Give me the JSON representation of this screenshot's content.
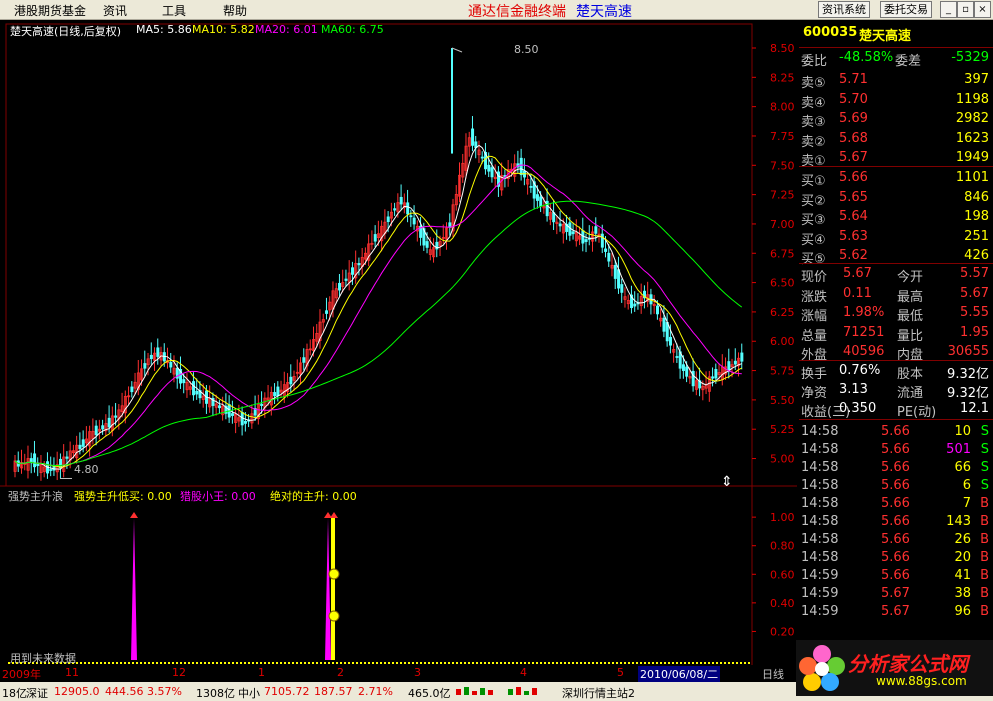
{
  "menubar": {
    "items": [
      "港股期货基金",
      "资讯",
      "工具",
      "帮助"
    ],
    "title_left": "通达信金融终端",
    "title_right": "楚天高速",
    "btn_news": "资讯系统",
    "btn_trade": "委托交易"
  },
  "main_chart": {
    "title": "楚天高速(日线,后复权)",
    "ma": [
      {
        "label": "MA5: 5.86",
        "color": "#ffffff"
      },
      {
        "label": "MA10: 5.82",
        "color": "#ffff00"
      },
      {
        "label": "MA20: 6.01",
        "color": "#ff00ff"
      },
      {
        "label": "MA60: 6.75",
        "color": "#00ff00"
      }
    ],
    "high_label": "8.50",
    "low_label": "4.80",
    "y_ticks": [
      "8.50",
      "8.25",
      "8.00",
      "7.75",
      "7.50",
      "7.25",
      "7.00",
      "6.75",
      "6.50",
      "6.25",
      "6.00",
      "5.75",
      "5.50",
      "5.25",
      "5.00"
    ]
  },
  "chart_data": {
    "type": "candlestick",
    "title": "楚天高速(日线,后复权)",
    "ylim": [
      4.8,
      8.5
    ],
    "high": 8.5,
    "low": 4.8,
    "close_series": [
      4.95,
      4.98,
      4.92,
      4.9,
      4.95,
      5.05,
      5.1,
      5.2,
      5.25,
      5.3,
      5.4,
      5.55,
      5.7,
      5.85,
      5.9,
      5.82,
      5.7,
      5.62,
      5.55,
      5.5,
      5.45,
      5.4,
      5.35,
      5.3,
      5.4,
      5.5,
      5.55,
      5.6,
      5.7,
      5.85,
      6.0,
      6.2,
      6.4,
      6.5,
      6.6,
      6.7,
      6.85,
      6.95,
      7.1,
      7.2,
      7.05,
      6.9,
      6.75,
      6.85,
      7.0,
      7.4,
      7.75,
      7.6,
      7.45,
      7.35,
      7.45,
      7.5,
      7.35,
      7.2,
      7.1,
      7.0,
      6.95,
      6.9,
      6.85,
      6.95,
      6.75,
      6.55,
      6.35,
      6.3,
      6.4,
      6.3,
      6.1,
      5.9,
      5.75,
      5.65,
      5.6,
      5.7,
      5.75,
      5.8,
      5.86
    ]
  },
  "indicator": {
    "name": "强势主升浪",
    "items": [
      {
        "label": "强势主升低买: 0.00",
        "color": "#ffff00"
      },
      {
        "label": "猎股小王: 0.00",
        "color": "#ff00ff"
      },
      {
        "label": "绝对的主升: 0.00",
        "color": "#ffff00"
      }
    ],
    "y_ticks": [
      "1.00",
      "0.80",
      "0.60",
      "0.40",
      "0.20"
    ],
    "note": "用到未来数据"
  },
  "x_axis": {
    "labels": [
      "2009年",
      "11",
      "12",
      "1",
      "2",
      "3",
      "4",
      "5"
    ],
    "current_date": "2010/06/08/二",
    "period_tab": "日线"
  },
  "quote": {
    "code": "600035",
    "name": "楚天高速",
    "weibi_label": "委比",
    "weibi": "-48.58%",
    "weicha_label": "委差",
    "weicha": "-5329",
    "sell": [
      {
        "label": "卖⑤",
        "price": "5.71",
        "vol": "397"
      },
      {
        "label": "卖④",
        "price": "5.70",
        "vol": "1198"
      },
      {
        "label": "卖③",
        "price": "5.69",
        "vol": "2982"
      },
      {
        "label": "卖②",
        "price": "5.68",
        "vol": "1623"
      },
      {
        "label": "卖①",
        "price": "5.67",
        "vol": "1949"
      }
    ],
    "buy": [
      {
        "label": "买①",
        "price": "5.66",
        "vol": "1101"
      },
      {
        "label": "买②",
        "price": "5.65",
        "vol": "846"
      },
      {
        "label": "买③",
        "price": "5.64",
        "vol": "198"
      },
      {
        "label": "买④",
        "price": "5.63",
        "vol": "251"
      },
      {
        "label": "买⑤",
        "price": "5.62",
        "vol": "426"
      }
    ],
    "stats": [
      {
        "l1": "现价",
        "v1": "5.67",
        "l2": "今开",
        "v2": "5.57"
      },
      {
        "l1": "涨跌",
        "v1": "0.11",
        "l2": "最高",
        "v2": "5.67"
      },
      {
        "l1": "涨幅",
        "v1": "1.98%",
        "l2": "最低",
        "v2": "5.55"
      },
      {
        "l1": "总量",
        "v1": "71251",
        "l2": "量比",
        "v2": "1.95"
      },
      {
        "l1": "外盘",
        "v1": "40596",
        "l2": "内盘",
        "v2": "30655"
      }
    ],
    "stats2": [
      {
        "l1": "换手",
        "v1": "0.76%",
        "l2": "股本",
        "v2": "9.32亿"
      },
      {
        "l1": "净资",
        "v1": "3.13",
        "l2": "流通",
        "v2": "9.32亿"
      },
      {
        "l1": "收益(三)",
        "v1": "0.350",
        "l2": "PE(动)",
        "v2": "12.1"
      }
    ],
    "ticks": [
      {
        "time": "14:58",
        "price": "5.66",
        "vol": "10",
        "bs": "S"
      },
      {
        "time": "14:58",
        "price": "5.66",
        "vol": "501",
        "bs": "S"
      },
      {
        "time": "14:58",
        "price": "5.66",
        "vol": "66",
        "bs": "S"
      },
      {
        "time": "14:58",
        "price": "5.66",
        "vol": "6",
        "bs": "S"
      },
      {
        "time": "14:58",
        "price": "5.66",
        "vol": "7",
        "bs": "B"
      },
      {
        "time": "14:58",
        "price": "5.66",
        "vol": "143",
        "bs": "B"
      },
      {
        "time": "14:58",
        "price": "5.66",
        "vol": "26",
        "bs": "B"
      },
      {
        "time": "14:58",
        "price": "5.66",
        "vol": "20",
        "bs": "B"
      },
      {
        "time": "14:59",
        "price": "5.66",
        "vol": "41",
        "bs": "B"
      },
      {
        "time": "14:59",
        "price": "5.67",
        "vol": "38",
        "bs": "B"
      },
      {
        "time": "14:59",
        "price": "5.67",
        "vol": "96",
        "bs": "B"
      }
    ]
  },
  "status": {
    "items": [
      "18亿",
      "深证",
      "12905.0",
      "444.56",
      "3.57%",
      "1308亿",
      "中小",
      "7105.72",
      "187.57",
      "2.71%",
      "465.0亿",
      "深圳行情主站2"
    ]
  },
  "watermark": {
    "text": "分析家公式网",
    "url": "www.88gs.com"
  },
  "colors": {
    "up": "#ff3030",
    "down": "#54ffff",
    "grid": "#800000",
    "ma5": "#ffffff",
    "ma10": "#ffff00",
    "ma20": "#ff00ff",
    "ma60": "#00ff00"
  }
}
